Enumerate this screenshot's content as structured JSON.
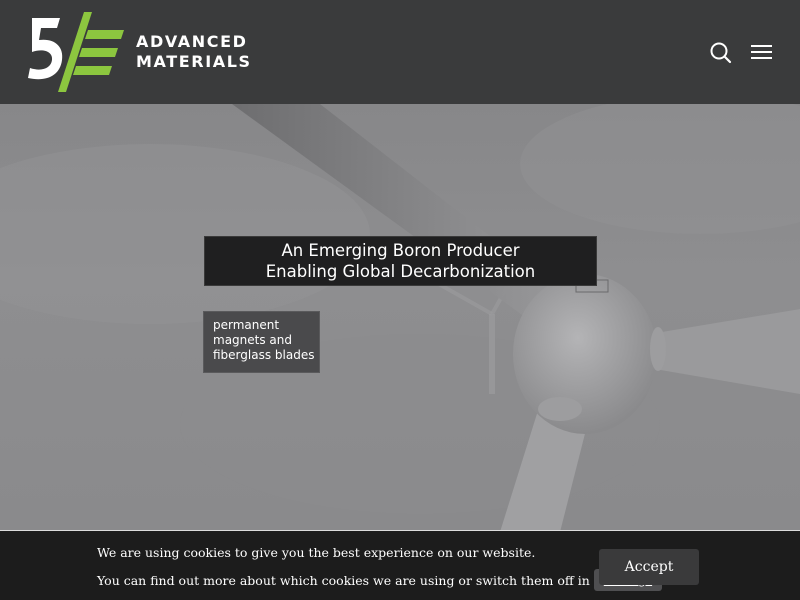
{
  "header": {
    "logo": {
      "mark": "5/E",
      "line1": "ADVANCED",
      "line2": "MATERIALS",
      "accent_color": "#8cc63f"
    },
    "search_icon": "search-icon",
    "menu_icon": "hamburger-menu-icon"
  },
  "hero": {
    "headline_line1": "An Emerging Boron Producer",
    "headline_line2": "Enabling Global Decarbonization",
    "subtag_line1": "permanent",
    "subtag_line2": "magnets and",
    "subtag_line3": "fiberglass blades"
  },
  "cookie_bar": {
    "line1": "We are using cookies to give you the best experience on our website.",
    "line2": "You can find out more about which cookies we are using or switch them off in",
    "settings_label": "settings",
    "trailing": ".",
    "accept_label": "Accept"
  }
}
